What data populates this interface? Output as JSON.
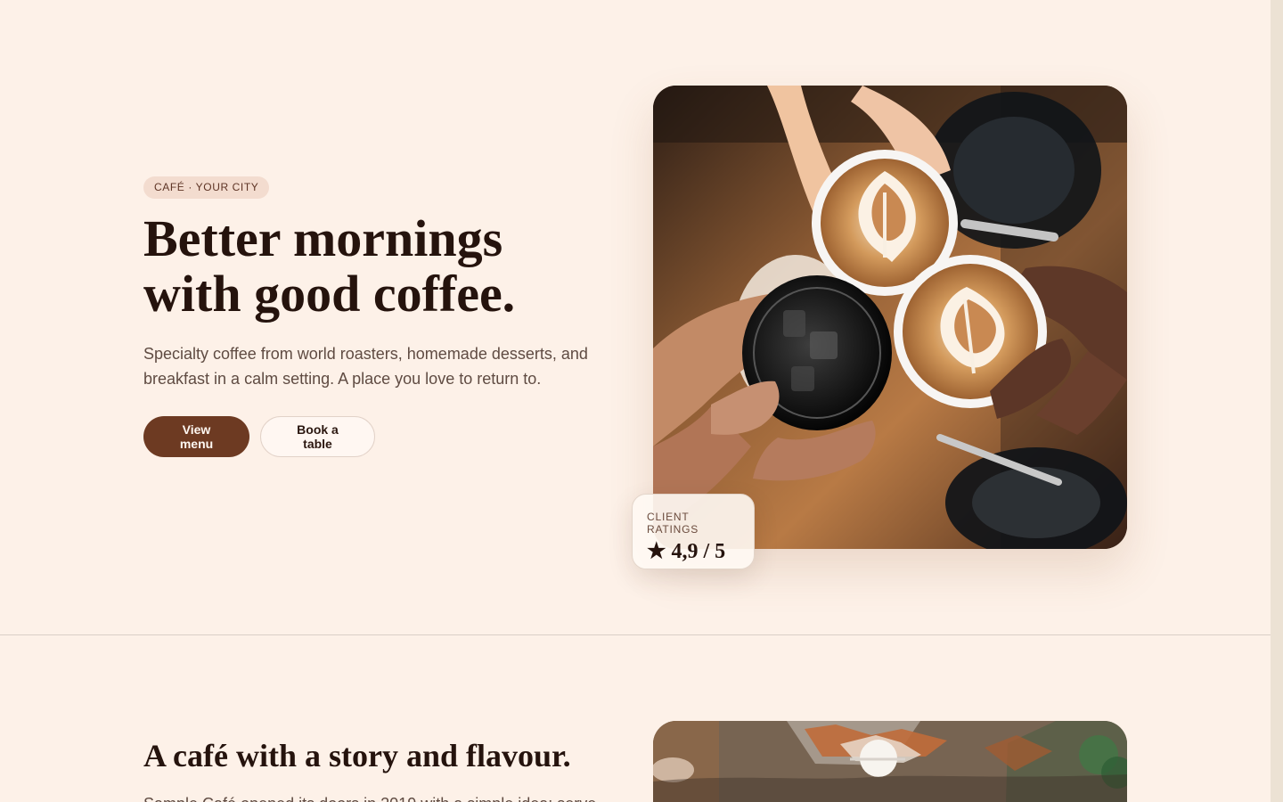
{
  "hero": {
    "badge": "CAFÉ · YOUR CITY",
    "title": "Better mornings with good coffee.",
    "description": "Specialty coffee from world roasters, homemade desserts, and breakfast in a calm setting. A place you love to return to.",
    "primary_button": "View menu",
    "secondary_button": "Book a table"
  },
  "rating": {
    "label": "CLIENT RATINGS",
    "value": "★ 4,9 / 5"
  },
  "story": {
    "title": "A café with a story and flavour.",
    "text": "Sample Café opened its doors in 2019 with a simple idea: serve"
  },
  "colors": {
    "background": "#fdf1e8",
    "accent": "#6d3a22",
    "badge_bg": "#f3dccf",
    "heading": "#25130d",
    "body_text": "#5f4b42"
  }
}
